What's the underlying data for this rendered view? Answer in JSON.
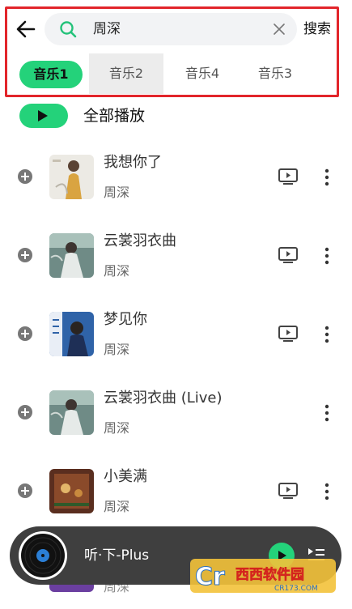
{
  "header": {
    "search_query": "周深",
    "search_button": "搜索"
  },
  "tabs": [
    {
      "label": "音乐1",
      "active": true
    },
    {
      "label": "音乐2"
    },
    {
      "label": "音乐4"
    },
    {
      "label": "音乐3"
    }
  ],
  "play_all": {
    "label": "全部播放"
  },
  "songs": [
    {
      "title": "我想你了",
      "artist": "周深",
      "has_mv": true
    },
    {
      "title": "云裳羽衣曲",
      "artist": "周深",
      "has_mv": true
    },
    {
      "title": "梦见你",
      "artist": "周深",
      "has_mv": true
    },
    {
      "title": "云裳羽衣曲 (Live)",
      "artist": "周深",
      "has_mv": false
    },
    {
      "title": "小美满",
      "artist": "周深",
      "has_mv": true
    },
    {
      "title": "",
      "artist": "周深",
      "has_mv": false
    }
  ],
  "player": {
    "title": "听·下-Plus"
  },
  "watermark": {
    "brand": "西西软件园",
    "url": "CR173.COM"
  },
  "colors": {
    "accent": "#24d27a",
    "highlight_box": "#e2252b",
    "player_bg": "#3f3f3f"
  }
}
